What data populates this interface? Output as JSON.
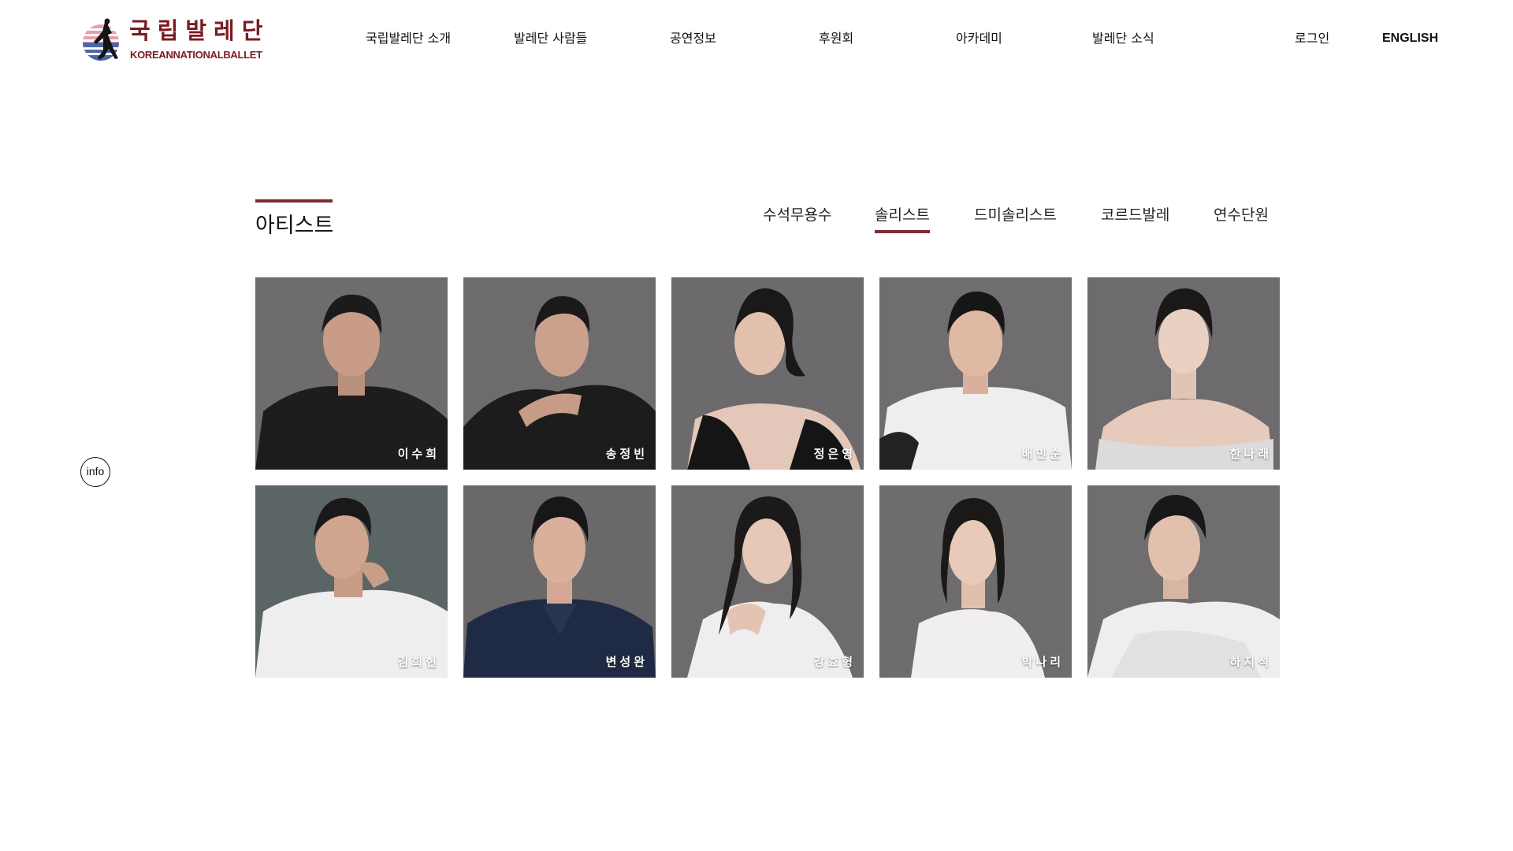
{
  "brand": {
    "name_ko": "국립발레단",
    "name_en": "KOREANNATIONALBALLET",
    "colors": {
      "brand": "#7a1b22",
      "accent": "#7e2a33"
    }
  },
  "nav": {
    "items": [
      "국립발레단 소개",
      "발레단 사람들",
      "공연정보",
      "후원회",
      "아카데미",
      "발레단 소식"
    ],
    "login": "로그인",
    "english": "ENGLISH"
  },
  "page": {
    "title": "아티스트",
    "tabs": [
      "수석무용수",
      "솔리스트",
      "드미솔리스트",
      "코르드발레",
      "연수단원"
    ],
    "active_tab": "솔리스트"
  },
  "artists": [
    {
      "name": "이수희"
    },
    {
      "name": "송정빈"
    },
    {
      "name": "정은영"
    },
    {
      "name": "배민순"
    },
    {
      "name": "한나래"
    },
    {
      "name": "김희현"
    },
    {
      "name": "변성완"
    },
    {
      "name": "강효형"
    },
    {
      "name": "박나리"
    },
    {
      "name": "하지석"
    }
  ],
  "info_button": "info"
}
